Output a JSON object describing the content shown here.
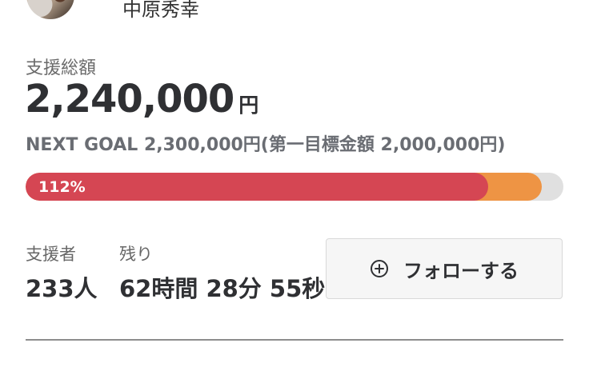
{
  "profile": {
    "name": "中原秀幸"
  },
  "funding": {
    "label": "支援総額",
    "amount": "2,240,000",
    "unit": "円",
    "next_goal": "NEXT GOAL 2,300,000円(第一目標金額 2,000,000円)",
    "progress_label": "112%",
    "progress_primary_fraction": 0.86,
    "progress_secondary_fraction": 0.96
  },
  "stats": {
    "backers": {
      "title": "支援者",
      "value": "233人"
    },
    "remaining": {
      "title": "残り",
      "value": "62時間 28分 55秒"
    }
  },
  "actions": {
    "follow_label": "フォローする",
    "follow_icon": "plus-circle-icon"
  },
  "colors": {
    "accent_red": "#d54653",
    "accent_orange": "#ee9444",
    "track_gray": "#e0e0e0",
    "text_dark": "#2f3033",
    "text_muted": "#6a6d73"
  }
}
